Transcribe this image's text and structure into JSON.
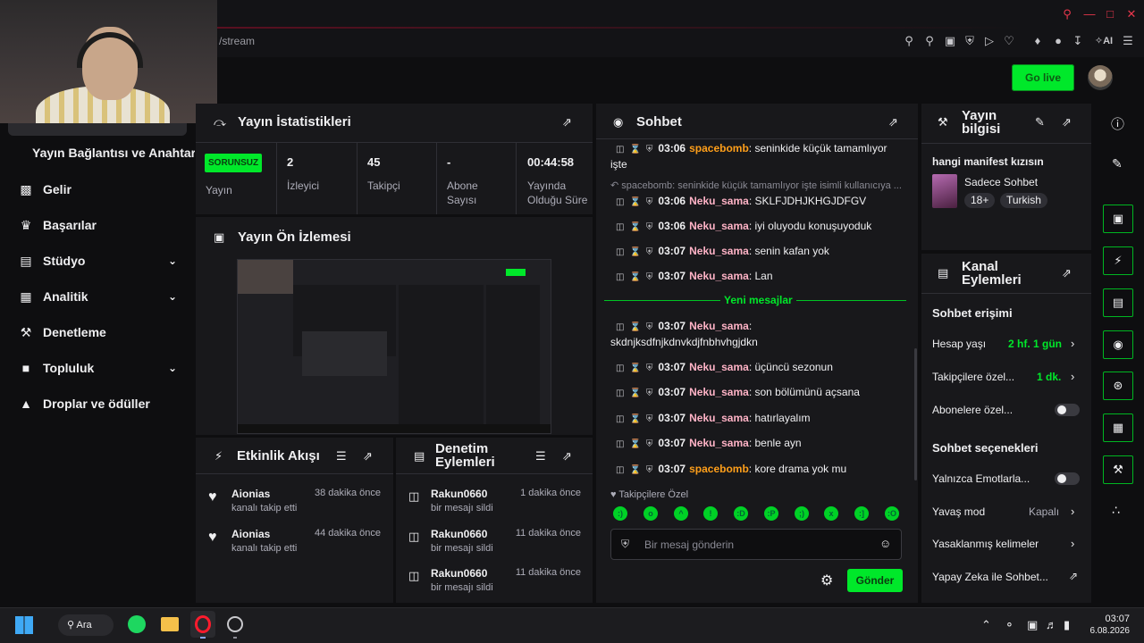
{
  "browser": {
    "url": "/stream",
    "ai_label": "AI"
  },
  "header": {
    "go_live": "Go live"
  },
  "sidebar": {
    "title": "Yayın Bağlantısı ve Anahtarı",
    "items": [
      {
        "label": "Gelir",
        "icon": "chart-icon",
        "expandable": false
      },
      {
        "label": "Başarılar",
        "icon": "trophy-icon",
        "expandable": false
      },
      {
        "label": "Stüdyo",
        "icon": "studio-icon",
        "expandable": true
      },
      {
        "label": "Analitik",
        "icon": "analytics-icon",
        "expandable": true
      },
      {
        "label": "Denetleme",
        "icon": "wrench-icon",
        "expandable": false
      },
      {
        "label": "Topluluk",
        "icon": "community-icon",
        "expandable": true
      },
      {
        "label": "Droplar ve ödüller",
        "icon": "drops-icon",
        "expandable": false
      }
    ]
  },
  "stats": {
    "title": "Yayın İstatistikleri",
    "status": "SORUNSUZ",
    "status_label": "Yayın",
    "viewers_value": "2",
    "viewers_label": "İzleyici",
    "followers_value": "45",
    "followers_label": "Takipçi",
    "subs_value": "-",
    "subs_label": "Abone Sayısı",
    "uptime_value": "00:44:58",
    "uptime_label": "Yayında Olduğu Süre"
  },
  "preview": {
    "title": "Yayın Ön İzlemesi"
  },
  "activity": {
    "title": "Etkinlik Akışı",
    "items": [
      {
        "user": "Aionias",
        "action": "kanalı takip etti",
        "time": "38 dakika önce"
      },
      {
        "user": "Aionias",
        "action": "kanalı takip etti",
        "time": "44 dakika önce"
      }
    ]
  },
  "moderation": {
    "title": "Denetim Eylemleri",
    "items": [
      {
        "user": "Rakun0660",
        "action": "bir mesajı sildi",
        "time": "1 dakika önce"
      },
      {
        "user": "Rakun0660",
        "action": "bir mesajı sildi",
        "time": "11 dakika önce"
      },
      {
        "user": "Rakun0660",
        "action": "bir mesajı sildi",
        "time": "11 dakika önce"
      }
    ]
  },
  "chat": {
    "title": "Sohbet",
    "reply_preview": "spacebomb: seninkide küçük tamamlıyor işte isimli kullanıcıya ...",
    "new_messages": "Yeni mesajlar",
    "followers_only": "Takipçilere Özel",
    "input_placeholder": "Bir mesaj gönderin",
    "send": "Gönder",
    "messages": [
      {
        "time": "03:06",
        "user": "spacebomb",
        "text": "seninkide küçük tamamlıyor işte"
      },
      {
        "time": "03:06",
        "user": "Neku_sama",
        "text": "SKLFJDHJKHGJDFGV"
      },
      {
        "time": "03:06",
        "user": "Neku_sama",
        "text": "iyi oluyodu konuşuyoduk"
      },
      {
        "time": "03:07",
        "user": "Neku_sama",
        "text": "senin kafan yok"
      },
      {
        "time": "03:07",
        "user": "Neku_sama",
        "text": "Lan"
      },
      {
        "time": "03:07",
        "user": "Neku_sama",
        "text": "skdnjksdfnjkdnvkdjfnbhvhgjdkn"
      },
      {
        "time": "03:07",
        "user": "Neku_sama",
        "text": "üçüncü sezonun"
      },
      {
        "time": "03:07",
        "user": "Neku_sama",
        "text": "son bölümünü açsana"
      },
      {
        "time": "03:07",
        "user": "Neku_sama",
        "text": "hatırlayalım"
      },
      {
        "time": "03:07",
        "user": "Neku_sama",
        "text": "benle ayn"
      },
      {
        "time": "03:07",
        "user": "spacebomb",
        "text": "kore drama yok mu"
      }
    ]
  },
  "stream_info": {
    "title": "Yayın bilgisi",
    "stream_title": "hangi manifest kızısın",
    "category": "Sadece Sohbet",
    "tags": [
      "18+",
      "Turkish"
    ]
  },
  "channel_actions": {
    "title": "Kanal Eylemleri",
    "chat_access": "Sohbet erişimi",
    "account_age_label": "Hesap yaşı",
    "account_age_value": "2 hf. 1 gün",
    "followers_only_label": "Takipçilere özel...",
    "followers_only_value": "1 dk.",
    "subs_only_label": "Abonelere özel...",
    "chat_options": "Sohbet seçenekleri",
    "emotes_only_label": "Yalnızca Emotlarla...",
    "slow_mode_label": "Yavaş mod",
    "slow_mode_value": "Kapalı",
    "banned_words_label": "Yasaklanmış kelimeler",
    "ai_chat_label": "Yapay Zeka ile Sohbet..."
  },
  "taskbar": {
    "search": "Ara",
    "time": "03:07",
    "date": "6.08.2026"
  },
  "colors": {
    "accent": "#00e82a",
    "panel": "#18181b",
    "background": "#0e0e10"
  }
}
